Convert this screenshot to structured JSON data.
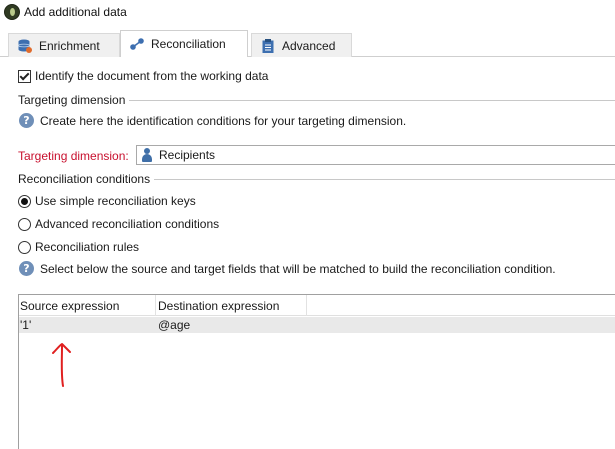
{
  "window": {
    "title": "Add additional data"
  },
  "tabs": [
    {
      "label": "Enrichment",
      "icon": "database-icon"
    },
    {
      "label": "Reconciliation",
      "icon": "link-nodes-icon"
    },
    {
      "label": "Advanced",
      "icon": "clipboard-icon"
    }
  ],
  "active_tab": "Reconciliation",
  "identify": {
    "label": "Identify the document from the working data",
    "checked": true
  },
  "targeting": {
    "section_title": "Targeting dimension",
    "help_text": "Create here the identification conditions for your targeting dimension.",
    "field_label": "Targeting dimension:",
    "field_value": "Recipients"
  },
  "reconciliation": {
    "section_title": "Reconciliation conditions",
    "options": [
      {
        "label": "Use simple reconciliation keys",
        "selected": true
      },
      {
        "label": "Advanced reconciliation conditions",
        "selected": false
      },
      {
        "label": "Reconciliation rules",
        "selected": false
      }
    ],
    "help_text": "Select below the source and target fields that will be matched to build the reconciliation condition."
  },
  "grid": {
    "columns": [
      "Source expression",
      "Destination expression"
    ],
    "rows": [
      [
        "'1'",
        "@age"
      ]
    ]
  },
  "colors": {
    "required_label": "#c8102e",
    "help_icon": "#6f8fb8",
    "annotation_arrow": "#e02020"
  }
}
